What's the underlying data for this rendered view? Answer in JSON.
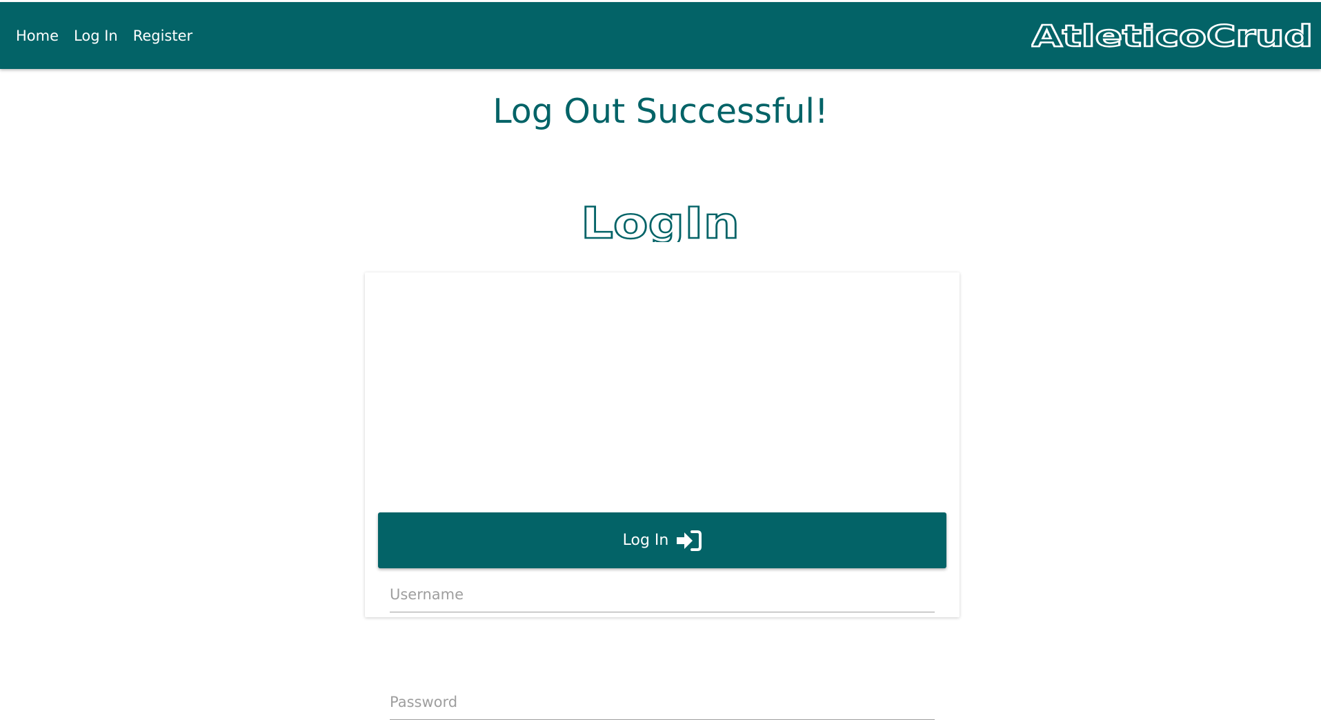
{
  "nav": {
    "links": [
      {
        "label": "Home"
      },
      {
        "label": "Log In"
      },
      {
        "label": "Register"
      }
    ],
    "brand": "AtleticoCrud"
  },
  "status_message": "Log Out Successful!",
  "login": {
    "title": "LogIn",
    "username_placeholder": "Username",
    "password_placeholder": "Password",
    "submit_label": "Log In",
    "submit_icon": "sign-in-icon"
  },
  "colors": {
    "primary": "#036367",
    "text_on_primary": "#ffffff",
    "placeholder": "#9e9e9e"
  }
}
